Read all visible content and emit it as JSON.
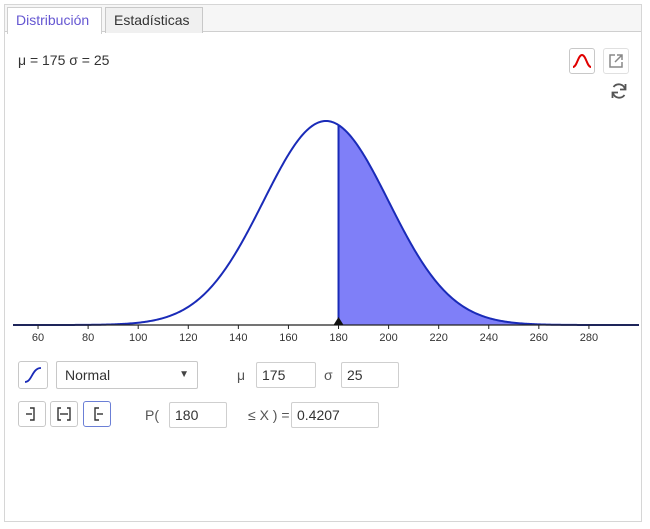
{
  "tabs": [
    {
      "label": "Distribución",
      "active": true
    },
    {
      "label": "Estadísticas",
      "active": false
    }
  ],
  "params_label": "μ = 175 σ = 25",
  "chart_data": {
    "type": "area",
    "distribution": "normal",
    "mean": 175,
    "sd": 25,
    "xlim": [
      50,
      300
    ],
    "x_ticks": [
      60,
      80,
      100,
      120,
      140,
      160,
      180,
      200,
      220,
      240,
      260,
      280
    ],
    "shade_from": 180,
    "shade_to": 300,
    "marker_x": 180,
    "curve_color": "#1a2bb8",
    "fill_color": "#7f7ff8"
  },
  "controls": {
    "distribution_value": "Normal",
    "mu_label": "μ",
    "mu_value": "175",
    "sigma_label": "σ",
    "sigma_value": "25",
    "p_open": "P(",
    "low_value": "180",
    "lex_label": "≤ X  ) =",
    "result_value": "0.4207"
  },
  "colors": {
    "accent": "#6557d2",
    "overlay_icon": "#e00000"
  }
}
